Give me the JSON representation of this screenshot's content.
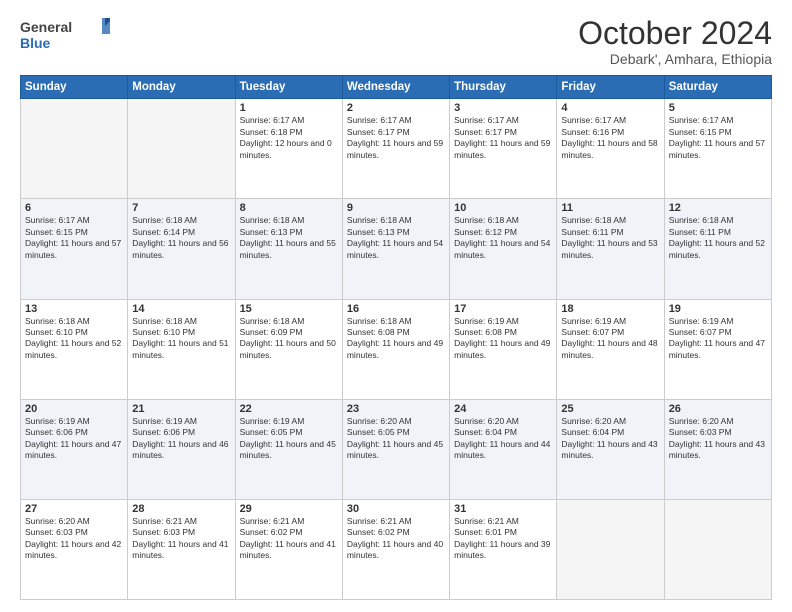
{
  "header": {
    "logo_general": "General",
    "logo_blue": "Blue",
    "title": "October 2024",
    "subtitle": "Debark', Amhara, Ethiopia"
  },
  "weekdays": [
    "Sunday",
    "Monday",
    "Tuesday",
    "Wednesday",
    "Thursday",
    "Friday",
    "Saturday"
  ],
  "weeks": [
    [
      {
        "day": null
      },
      {
        "day": null
      },
      {
        "day": "1",
        "rise": "6:17 AM",
        "set": "6:18 PM",
        "daylight": "12 hours and 0 minutes."
      },
      {
        "day": "2",
        "rise": "6:17 AM",
        "set": "6:17 PM",
        "daylight": "11 hours and 59 minutes."
      },
      {
        "day": "3",
        "rise": "6:17 AM",
        "set": "6:17 PM",
        "daylight": "11 hours and 59 minutes."
      },
      {
        "day": "4",
        "rise": "6:17 AM",
        "set": "6:16 PM",
        "daylight": "11 hours and 58 minutes."
      },
      {
        "day": "5",
        "rise": "6:17 AM",
        "set": "6:15 PM",
        "daylight": "11 hours and 57 minutes."
      }
    ],
    [
      {
        "day": "6",
        "rise": "6:17 AM",
        "set": "6:15 PM",
        "daylight": "11 hours and 57 minutes."
      },
      {
        "day": "7",
        "rise": "6:18 AM",
        "set": "6:14 PM",
        "daylight": "11 hours and 56 minutes."
      },
      {
        "day": "8",
        "rise": "6:18 AM",
        "set": "6:13 PM",
        "daylight": "11 hours and 55 minutes."
      },
      {
        "day": "9",
        "rise": "6:18 AM",
        "set": "6:13 PM",
        "daylight": "11 hours and 54 minutes."
      },
      {
        "day": "10",
        "rise": "6:18 AM",
        "set": "6:12 PM",
        "daylight": "11 hours and 54 minutes."
      },
      {
        "day": "11",
        "rise": "6:18 AM",
        "set": "6:11 PM",
        "daylight": "11 hours and 53 minutes."
      },
      {
        "day": "12",
        "rise": "6:18 AM",
        "set": "6:11 PM",
        "daylight": "11 hours and 52 minutes."
      }
    ],
    [
      {
        "day": "13",
        "rise": "6:18 AM",
        "set": "6:10 PM",
        "daylight": "11 hours and 52 minutes."
      },
      {
        "day": "14",
        "rise": "6:18 AM",
        "set": "6:10 PM",
        "daylight": "11 hours and 51 minutes."
      },
      {
        "day": "15",
        "rise": "6:18 AM",
        "set": "6:09 PM",
        "daylight": "11 hours and 50 minutes."
      },
      {
        "day": "16",
        "rise": "6:18 AM",
        "set": "6:08 PM",
        "daylight": "11 hours and 49 minutes."
      },
      {
        "day": "17",
        "rise": "6:19 AM",
        "set": "6:08 PM",
        "daylight": "11 hours and 49 minutes."
      },
      {
        "day": "18",
        "rise": "6:19 AM",
        "set": "6:07 PM",
        "daylight": "11 hours and 48 minutes."
      },
      {
        "day": "19",
        "rise": "6:19 AM",
        "set": "6:07 PM",
        "daylight": "11 hours and 47 minutes."
      }
    ],
    [
      {
        "day": "20",
        "rise": "6:19 AM",
        "set": "6:06 PM",
        "daylight": "11 hours and 47 minutes."
      },
      {
        "day": "21",
        "rise": "6:19 AM",
        "set": "6:06 PM",
        "daylight": "11 hours and 46 minutes."
      },
      {
        "day": "22",
        "rise": "6:19 AM",
        "set": "6:05 PM",
        "daylight": "11 hours and 45 minutes."
      },
      {
        "day": "23",
        "rise": "6:20 AM",
        "set": "6:05 PM",
        "daylight": "11 hours and 45 minutes."
      },
      {
        "day": "24",
        "rise": "6:20 AM",
        "set": "6:04 PM",
        "daylight": "11 hours and 44 minutes."
      },
      {
        "day": "25",
        "rise": "6:20 AM",
        "set": "6:04 PM",
        "daylight": "11 hours and 43 minutes."
      },
      {
        "day": "26",
        "rise": "6:20 AM",
        "set": "6:03 PM",
        "daylight": "11 hours and 43 minutes."
      }
    ],
    [
      {
        "day": "27",
        "rise": "6:20 AM",
        "set": "6:03 PM",
        "daylight": "11 hours and 42 minutes."
      },
      {
        "day": "28",
        "rise": "6:21 AM",
        "set": "6:03 PM",
        "daylight": "11 hours and 41 minutes."
      },
      {
        "day": "29",
        "rise": "6:21 AM",
        "set": "6:02 PM",
        "daylight": "11 hours and 41 minutes."
      },
      {
        "day": "30",
        "rise": "6:21 AM",
        "set": "6:02 PM",
        "daylight": "11 hours and 40 minutes."
      },
      {
        "day": "31",
        "rise": "6:21 AM",
        "set": "6:01 PM",
        "daylight": "11 hours and 39 minutes."
      },
      {
        "day": null
      },
      {
        "day": null
      }
    ]
  ],
  "labels": {
    "sunrise": "Sunrise:",
    "sunset": "Sunset:",
    "daylight": "Daylight:"
  }
}
